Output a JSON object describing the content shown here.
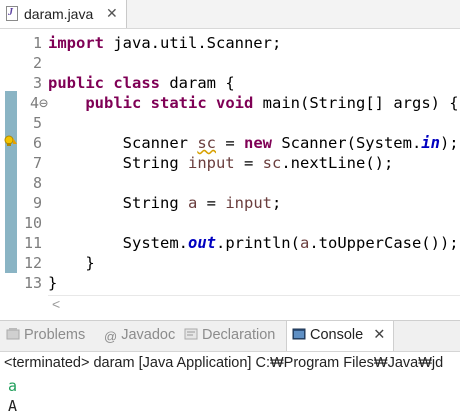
{
  "editor_tab": {
    "title": "daram.java",
    "close": "✕"
  },
  "code": {
    "line_numbers": [
      "1",
      "2",
      "3",
      "4⊖",
      "5",
      "6",
      "7",
      "8",
      "9",
      "10",
      "11",
      "12",
      "13"
    ]
  },
  "console": {
    "tabs": {
      "problems": "Problems",
      "javadoc": "Javadoc",
      "declaration": "Declaration",
      "console": "Console",
      "console_close": "✕"
    },
    "status": "<terminated> daram [Java Application] C:₩Program Files₩Java₩jd",
    "input_echo": "a",
    "output": "A"
  },
  "colors": {
    "keyword": "#7f0055",
    "static_field": "#0000c0",
    "input_text": "#1f9e5a",
    "change_marker": "#8ab4c4"
  }
}
